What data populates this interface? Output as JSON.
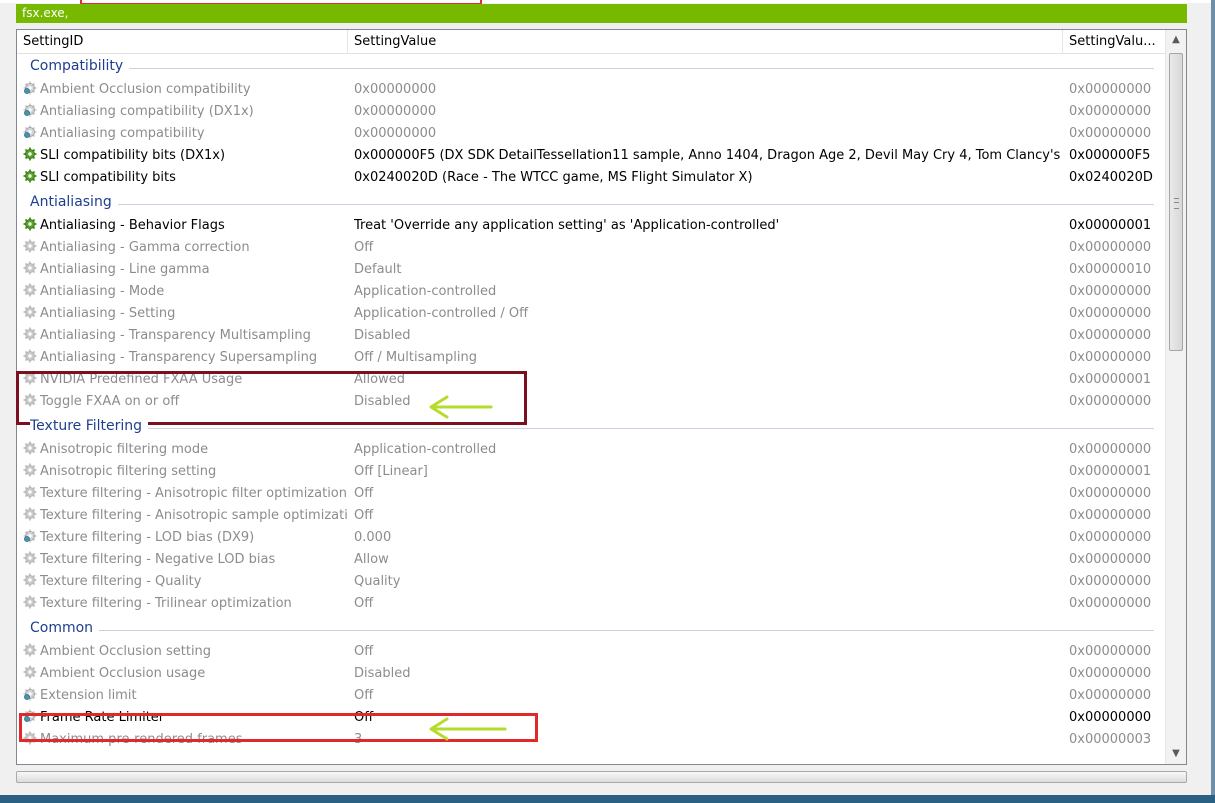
{
  "window": {
    "process_label": "fsx.exe,"
  },
  "columns": {
    "setting_id": "SettingID",
    "setting_value": "SettingValue",
    "setting_value_hex": "SettingValu..."
  },
  "icon_names": {
    "gear_green": "gear-green-icon",
    "gear_globe": "gear-globe-icon",
    "gear_grey": "gear-grey-icon"
  },
  "colors": {
    "accent_green": "#76b900",
    "group_blue": "#1e3f8f",
    "highlight_dark_red": "#7a1020",
    "highlight_red": "#e02a2a",
    "arrow_green": "#b5dc2a"
  },
  "groups": [
    {
      "name": "Compatibility",
      "rows": [
        {
          "id": "Ambient Occlusion compatibility",
          "value": "0x00000000",
          "hex": "0x00000000",
          "icon": "gear-globe-icon",
          "style": "grey"
        },
        {
          "id": "Antialiasing compatibility (DX1x)",
          "value": "0x00000000",
          "hex": "0x00000000",
          "icon": "gear-globe-icon",
          "style": "grey"
        },
        {
          "id": "Antialiasing compatibility",
          "value": "0x00000000",
          "hex": "0x00000000",
          "icon": "gear-globe-icon",
          "style": "grey"
        },
        {
          "id": "SLI compatibility bits (DX1x)",
          "value": "0x000000F5 (DX SDK DetailTessellation11 sample, Anno 1404, Dragon Age 2, Devil May Cry 4, Tom Clancy's...",
          "hex": "0x000000F5",
          "icon": "gear-green-icon",
          "style": "dark"
        },
        {
          "id": "SLI compatibility bits",
          "value": "0x0240020D (Race - The WTCC game, MS Flight Simulator X)",
          "hex": "0x0240020D",
          "icon": "gear-green-icon",
          "style": "dark"
        }
      ]
    },
    {
      "name": "Antialiasing",
      "rows": [
        {
          "id": "Antialiasing - Behavior Flags",
          "value": "Treat 'Override any application setting' as 'Application-controlled'",
          "hex": "0x00000001",
          "icon": "gear-green-icon",
          "style": "dark"
        },
        {
          "id": "Antialiasing - Gamma correction",
          "value": "Off",
          "hex": "0x00000000",
          "icon": "gear-grey-icon",
          "style": "grey"
        },
        {
          "id": "Antialiasing - Line gamma",
          "value": "Default",
          "hex": "0x00000010",
          "icon": "gear-grey-icon",
          "style": "grey"
        },
        {
          "id": "Antialiasing - Mode",
          "value": "Application-controlled",
          "hex": "0x00000000",
          "icon": "gear-grey-icon",
          "style": "grey"
        },
        {
          "id": "Antialiasing - Setting",
          "value": "Application-controlled / Off",
          "hex": "0x00000000",
          "icon": "gear-grey-icon",
          "style": "grey"
        },
        {
          "id": "Antialiasing - Transparency Multisampling",
          "value": "Disabled",
          "hex": "0x00000000",
          "icon": "gear-grey-icon",
          "style": "grey"
        },
        {
          "id": "Antialiasing - Transparency Supersampling",
          "value": "Off / Multisampling",
          "hex": "0x00000000",
          "icon": "gear-grey-icon",
          "style": "grey"
        },
        {
          "id": "NVIDIA Predefined FXAA Usage",
          "value": "Allowed",
          "hex": "0x00000001",
          "icon": "gear-grey-icon",
          "style": "grey"
        },
        {
          "id": "Toggle FXAA on or off",
          "value": "Disabled",
          "hex": "0x00000000",
          "icon": "gear-grey-icon",
          "style": "grey"
        }
      ]
    },
    {
      "name": "Texture Filtering",
      "rows": [
        {
          "id": "Anisotropic filtering mode",
          "value": "Application-controlled",
          "hex": "0x00000000",
          "icon": "gear-grey-icon",
          "style": "grey"
        },
        {
          "id": "Anisotropic filtering setting",
          "value": "Off [Linear]",
          "hex": "0x00000001",
          "icon": "gear-grey-icon",
          "style": "grey"
        },
        {
          "id": "Texture filtering - Anisotropic filter optimization",
          "value": "Off",
          "hex": "0x00000000",
          "icon": "gear-grey-icon",
          "style": "grey"
        },
        {
          "id": "Texture filtering - Anisotropic sample optimizati...",
          "value": "Off",
          "hex": "0x00000000",
          "icon": "gear-grey-icon",
          "style": "grey"
        },
        {
          "id": "Texture filtering - LOD bias (DX9)",
          "value": "0.000",
          "hex": "0x00000000",
          "icon": "gear-globe-icon",
          "style": "grey"
        },
        {
          "id": "Texture filtering - Negative LOD bias",
          "value": "Allow",
          "hex": "0x00000000",
          "icon": "gear-grey-icon",
          "style": "grey"
        },
        {
          "id": "Texture filtering - Quality",
          "value": "Quality",
          "hex": "0x00000000",
          "icon": "gear-grey-icon",
          "style": "grey"
        },
        {
          "id": "Texture filtering - Trilinear optimization",
          "value": "Off",
          "hex": "0x00000000",
          "icon": "gear-grey-icon",
          "style": "grey"
        }
      ]
    },
    {
      "name": "Common",
      "rows": [
        {
          "id": "Ambient Occlusion setting",
          "value": "Off",
          "hex": "0x00000000",
          "icon": "gear-grey-icon",
          "style": "grey"
        },
        {
          "id": "Ambient Occlusion usage",
          "value": "Disabled",
          "hex": "0x00000000",
          "icon": "gear-grey-icon",
          "style": "grey"
        },
        {
          "id": "Extension limit",
          "value": "Off",
          "hex": "0x00000000",
          "icon": "gear-globe-icon",
          "style": "grey"
        },
        {
          "id": "Frame Rate Limiter",
          "value": "Off",
          "hex": "0x00000000",
          "icon": "gear-globe-icon",
          "style": "dark"
        },
        {
          "id": "Maximum pre-rendered frames",
          "value": "3",
          "hex": "0x00000003",
          "icon": "gear-grey-icon",
          "style": "grey"
        }
      ]
    }
  ]
}
